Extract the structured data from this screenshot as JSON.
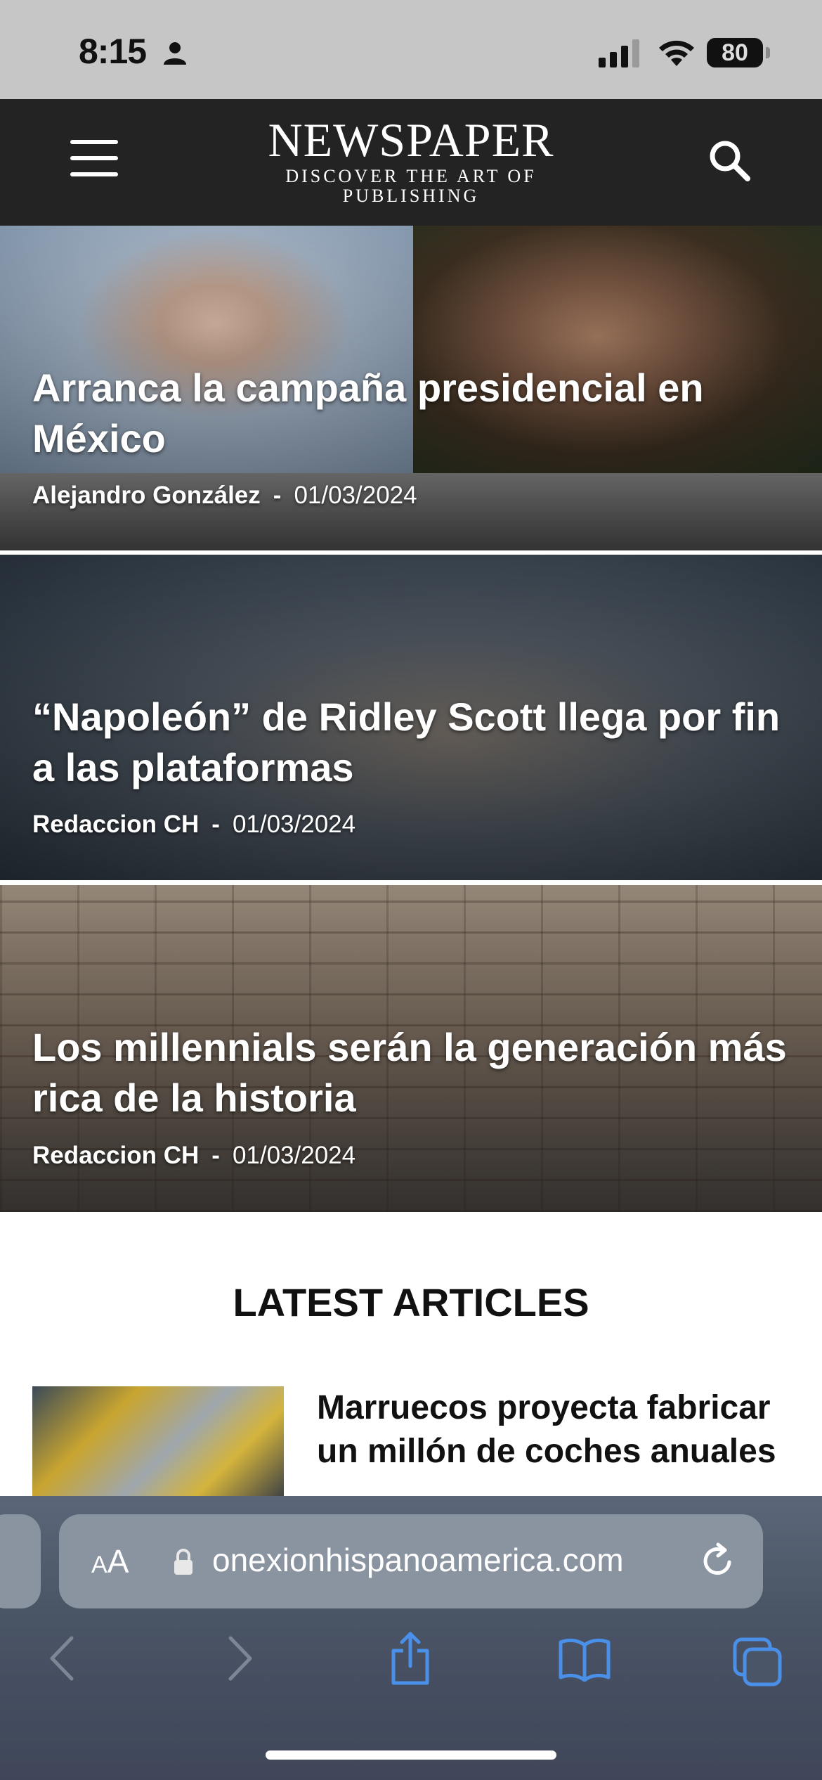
{
  "status_bar": {
    "time": "8:15",
    "battery": "80"
  },
  "header": {
    "brand_name": "NEWSPAPER",
    "tagline": "DISCOVER THE ART OF PUBLISHING"
  },
  "hero_articles": [
    {
      "title": "Arranca la campaña presidencial en México",
      "author": "Alejandro González",
      "separator": "-",
      "date": "01/03/2024"
    },
    {
      "title": "“Napoleón” de Ridley Scott llega por fin a las plataformas",
      "author": "Redaccion CH",
      "separator": "-",
      "date": "01/03/2024"
    },
    {
      "title": "Los millennials serán la generación más rica de la historia",
      "author": "Redaccion CH",
      "separator": "-",
      "date": "01/03/2024"
    }
  ],
  "latest": {
    "heading": "LATEST ARTICLES",
    "articles": [
      {
        "title": "Marruecos proyecta fabricar un millón de coches anuales"
      }
    ]
  },
  "browser": {
    "text_size_label_small": "A",
    "text_size_label_large": "A",
    "url": "onexionhispanoamerica.com",
    "accent_color": "#4a8fe8"
  }
}
